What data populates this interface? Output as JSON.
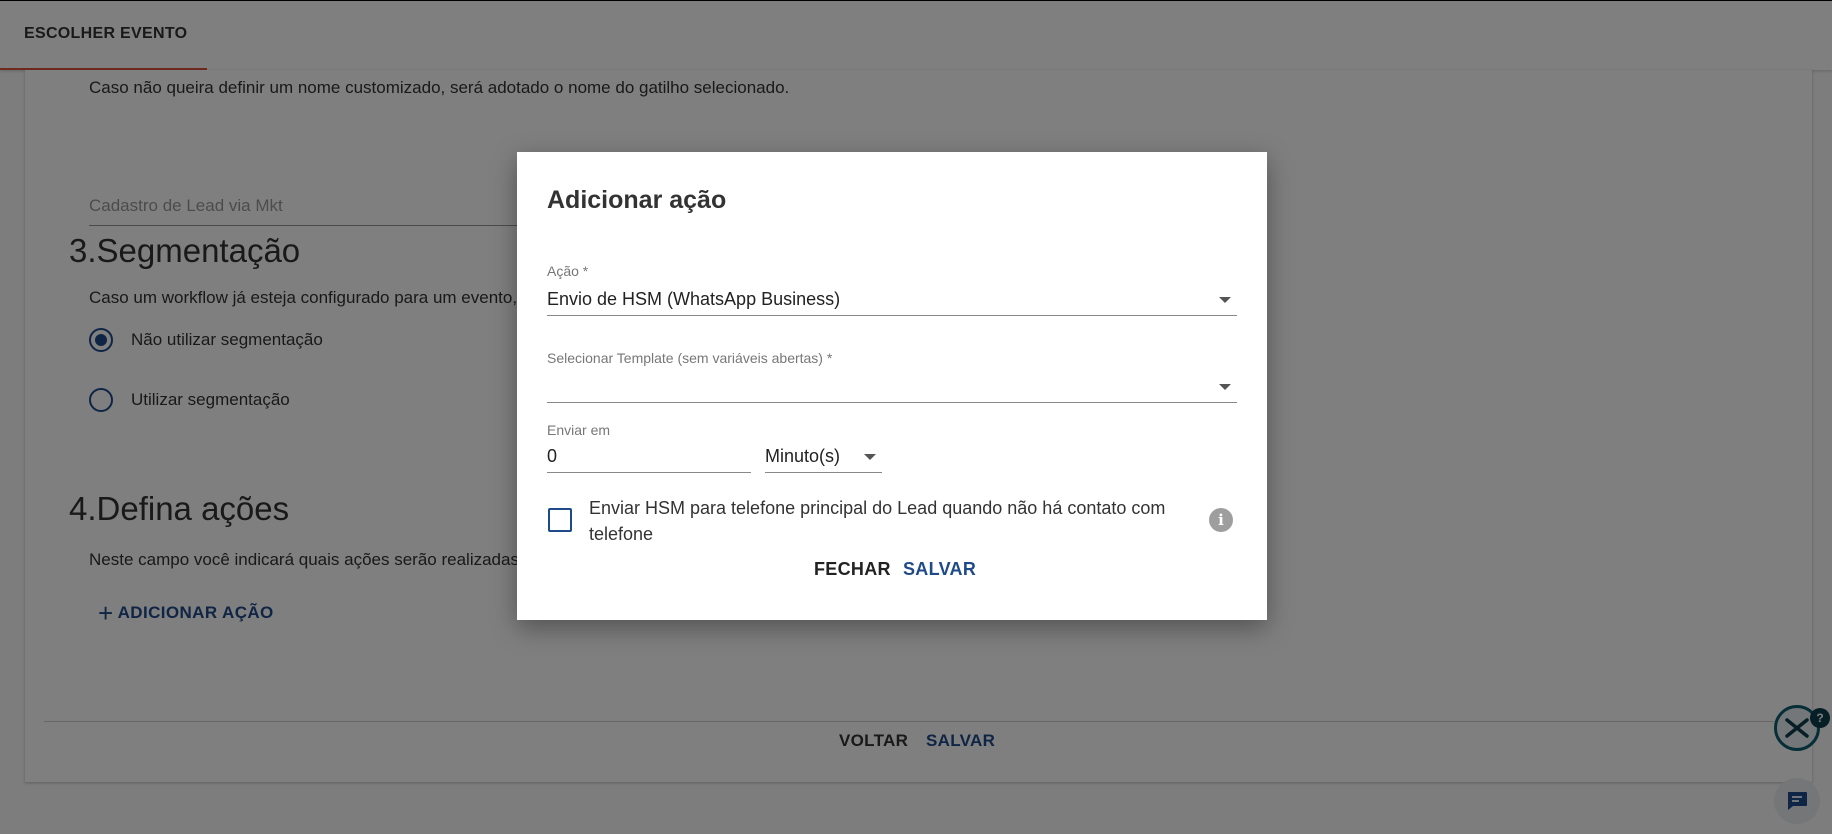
{
  "topbar": {
    "tab_label": "ESCOLHER EVENTO"
  },
  "page": {
    "name_hint": "Caso não queira definir um nome customizado, será adotado o nome do gatilho selecionado.",
    "name_value": "Cadastro de Lead via Mkt",
    "segmentation": {
      "title": "3.Segmentação",
      "hint": "Caso um workflow já esteja configurado para um evento,",
      "options": [
        {
          "label": "Não utilizar segmentação",
          "checked": true
        },
        {
          "label": "Utilizar segmentação",
          "checked": false
        }
      ]
    },
    "actions": {
      "title": "4.Defina ações",
      "hint": "Neste campo você indicará quais ações serão realizadas",
      "add_label": "ADICIONAR AÇÃO",
      "add_icon": "plus-icon"
    },
    "footer": {
      "back_label": "VOLTAR",
      "save_label": "SALVAR"
    }
  },
  "dialog": {
    "title": "Adicionar ação",
    "action_field": {
      "label": "Ação *",
      "value": "Envio de HSM (WhatsApp Business)"
    },
    "template_field": {
      "label": "Selecionar Template (sem variáveis abertas) *",
      "value": ""
    },
    "send_in": {
      "label": "Enviar em",
      "value": "0",
      "unit": "Minuto(s)"
    },
    "checkbox": {
      "label": "Enviar HSM para telefone principal do Lead quando não há contato com telefone",
      "checked": false
    },
    "info_icon": "info-icon",
    "close_label": "FECHAR",
    "save_label": "SALVAR"
  },
  "widgets": {
    "help_badge": "?"
  },
  "colors": {
    "primary": "#1e4a8a",
    "tab_indicator": "#e0553a",
    "overlay": "rgba(0,0,0,0.5)",
    "widget_teal": "#0d5c6e"
  }
}
